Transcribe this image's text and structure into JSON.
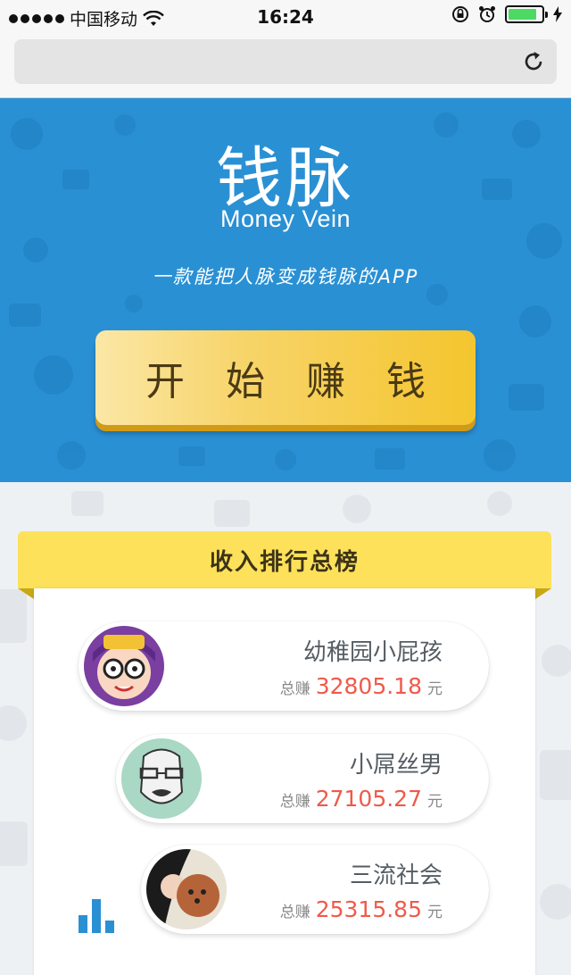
{
  "status_bar": {
    "carrier": "中国移动",
    "time": "16:24",
    "battery_level": 0.85
  },
  "hero": {
    "title": "钱脉",
    "subtitle": "Money Vein",
    "slogan": "一款能把人脉变成钱脉的APP",
    "start_button": "开 始 赚 钱",
    "bg_color": "#2a90d4"
  },
  "leaderboard": {
    "title": "收入排行总榜",
    "earn_label": "总赚",
    "unit": "元",
    "entries": [
      {
        "name": "幼稚园小屁孩",
        "amount": "32805.18",
        "avatar": "cartoon-girl-avatar"
      },
      {
        "name": "小屌丝男",
        "amount": "27105.27",
        "avatar": "sketch-man-avatar"
      },
      {
        "name": "三流社会",
        "amount": "25315.85",
        "avatar": "girl-with-dog-avatar"
      }
    ]
  },
  "icons": {
    "reload": "reload-icon",
    "wifi": "wifi-icon",
    "lock": "rotation-lock-icon",
    "alarm": "alarm-icon",
    "charging": "charging-icon",
    "chart": "bar-chart-icon"
  },
  "colors": {
    "accent_yellow": "#fde15a",
    "amount_red": "#ef5a4a"
  }
}
